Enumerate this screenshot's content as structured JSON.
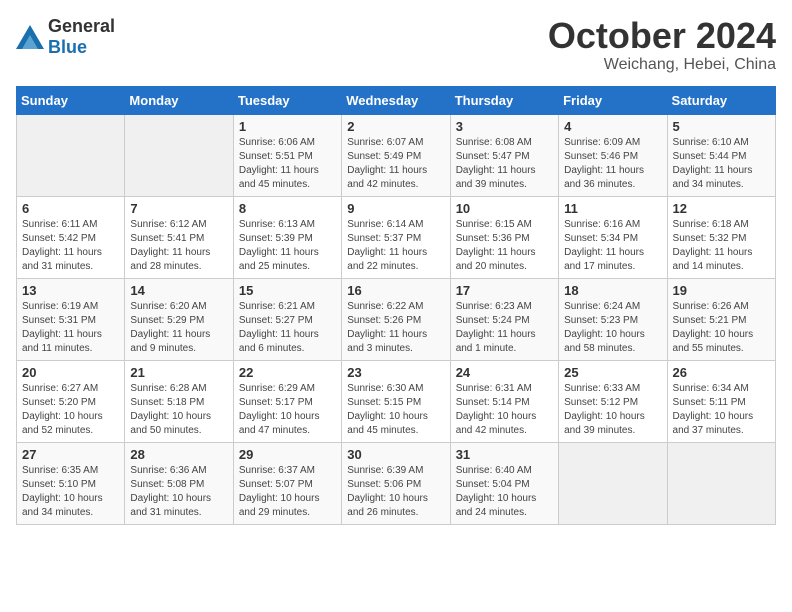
{
  "logo": {
    "general": "General",
    "blue": "Blue"
  },
  "header": {
    "month": "October 2024",
    "location": "Weichang, Hebei, China"
  },
  "weekdays": [
    "Sunday",
    "Monday",
    "Tuesday",
    "Wednesday",
    "Thursday",
    "Friday",
    "Saturday"
  ],
  "weeks": [
    [
      {
        "day": "",
        "sunrise": "",
        "sunset": "",
        "daylight": ""
      },
      {
        "day": "",
        "sunrise": "",
        "sunset": "",
        "daylight": ""
      },
      {
        "day": "1",
        "sunrise": "Sunrise: 6:06 AM",
        "sunset": "Sunset: 5:51 PM",
        "daylight": "Daylight: 11 hours and 45 minutes."
      },
      {
        "day": "2",
        "sunrise": "Sunrise: 6:07 AM",
        "sunset": "Sunset: 5:49 PM",
        "daylight": "Daylight: 11 hours and 42 minutes."
      },
      {
        "day": "3",
        "sunrise": "Sunrise: 6:08 AM",
        "sunset": "Sunset: 5:47 PM",
        "daylight": "Daylight: 11 hours and 39 minutes."
      },
      {
        "day": "4",
        "sunrise": "Sunrise: 6:09 AM",
        "sunset": "Sunset: 5:46 PM",
        "daylight": "Daylight: 11 hours and 36 minutes."
      },
      {
        "day": "5",
        "sunrise": "Sunrise: 6:10 AM",
        "sunset": "Sunset: 5:44 PM",
        "daylight": "Daylight: 11 hours and 34 minutes."
      }
    ],
    [
      {
        "day": "6",
        "sunrise": "Sunrise: 6:11 AM",
        "sunset": "Sunset: 5:42 PM",
        "daylight": "Daylight: 11 hours and 31 minutes."
      },
      {
        "day": "7",
        "sunrise": "Sunrise: 6:12 AM",
        "sunset": "Sunset: 5:41 PM",
        "daylight": "Daylight: 11 hours and 28 minutes."
      },
      {
        "day": "8",
        "sunrise": "Sunrise: 6:13 AM",
        "sunset": "Sunset: 5:39 PM",
        "daylight": "Daylight: 11 hours and 25 minutes."
      },
      {
        "day": "9",
        "sunrise": "Sunrise: 6:14 AM",
        "sunset": "Sunset: 5:37 PM",
        "daylight": "Daylight: 11 hours and 22 minutes."
      },
      {
        "day": "10",
        "sunrise": "Sunrise: 6:15 AM",
        "sunset": "Sunset: 5:36 PM",
        "daylight": "Daylight: 11 hours and 20 minutes."
      },
      {
        "day": "11",
        "sunrise": "Sunrise: 6:16 AM",
        "sunset": "Sunset: 5:34 PM",
        "daylight": "Daylight: 11 hours and 17 minutes."
      },
      {
        "day": "12",
        "sunrise": "Sunrise: 6:18 AM",
        "sunset": "Sunset: 5:32 PM",
        "daylight": "Daylight: 11 hours and 14 minutes."
      }
    ],
    [
      {
        "day": "13",
        "sunrise": "Sunrise: 6:19 AM",
        "sunset": "Sunset: 5:31 PM",
        "daylight": "Daylight: 11 hours and 11 minutes."
      },
      {
        "day": "14",
        "sunrise": "Sunrise: 6:20 AM",
        "sunset": "Sunset: 5:29 PM",
        "daylight": "Daylight: 11 hours and 9 minutes."
      },
      {
        "day": "15",
        "sunrise": "Sunrise: 6:21 AM",
        "sunset": "Sunset: 5:27 PM",
        "daylight": "Daylight: 11 hours and 6 minutes."
      },
      {
        "day": "16",
        "sunrise": "Sunrise: 6:22 AM",
        "sunset": "Sunset: 5:26 PM",
        "daylight": "Daylight: 11 hours and 3 minutes."
      },
      {
        "day": "17",
        "sunrise": "Sunrise: 6:23 AM",
        "sunset": "Sunset: 5:24 PM",
        "daylight": "Daylight: 11 hours and 1 minute."
      },
      {
        "day": "18",
        "sunrise": "Sunrise: 6:24 AM",
        "sunset": "Sunset: 5:23 PM",
        "daylight": "Daylight: 10 hours and 58 minutes."
      },
      {
        "day": "19",
        "sunrise": "Sunrise: 6:26 AM",
        "sunset": "Sunset: 5:21 PM",
        "daylight": "Daylight: 10 hours and 55 minutes."
      }
    ],
    [
      {
        "day": "20",
        "sunrise": "Sunrise: 6:27 AM",
        "sunset": "Sunset: 5:20 PM",
        "daylight": "Daylight: 10 hours and 52 minutes."
      },
      {
        "day": "21",
        "sunrise": "Sunrise: 6:28 AM",
        "sunset": "Sunset: 5:18 PM",
        "daylight": "Daylight: 10 hours and 50 minutes."
      },
      {
        "day": "22",
        "sunrise": "Sunrise: 6:29 AM",
        "sunset": "Sunset: 5:17 PM",
        "daylight": "Daylight: 10 hours and 47 minutes."
      },
      {
        "day": "23",
        "sunrise": "Sunrise: 6:30 AM",
        "sunset": "Sunset: 5:15 PM",
        "daylight": "Daylight: 10 hours and 45 minutes."
      },
      {
        "day": "24",
        "sunrise": "Sunrise: 6:31 AM",
        "sunset": "Sunset: 5:14 PM",
        "daylight": "Daylight: 10 hours and 42 minutes."
      },
      {
        "day": "25",
        "sunrise": "Sunrise: 6:33 AM",
        "sunset": "Sunset: 5:12 PM",
        "daylight": "Daylight: 10 hours and 39 minutes."
      },
      {
        "day": "26",
        "sunrise": "Sunrise: 6:34 AM",
        "sunset": "Sunset: 5:11 PM",
        "daylight": "Daylight: 10 hours and 37 minutes."
      }
    ],
    [
      {
        "day": "27",
        "sunrise": "Sunrise: 6:35 AM",
        "sunset": "Sunset: 5:10 PM",
        "daylight": "Daylight: 10 hours and 34 minutes."
      },
      {
        "day": "28",
        "sunrise": "Sunrise: 6:36 AM",
        "sunset": "Sunset: 5:08 PM",
        "daylight": "Daylight: 10 hours and 31 minutes."
      },
      {
        "day": "29",
        "sunrise": "Sunrise: 6:37 AM",
        "sunset": "Sunset: 5:07 PM",
        "daylight": "Daylight: 10 hours and 29 minutes."
      },
      {
        "day": "30",
        "sunrise": "Sunrise: 6:39 AM",
        "sunset": "Sunset: 5:06 PM",
        "daylight": "Daylight: 10 hours and 26 minutes."
      },
      {
        "day": "31",
        "sunrise": "Sunrise: 6:40 AM",
        "sunset": "Sunset: 5:04 PM",
        "daylight": "Daylight: 10 hours and 24 minutes."
      },
      {
        "day": "",
        "sunrise": "",
        "sunset": "",
        "daylight": ""
      },
      {
        "day": "",
        "sunrise": "",
        "sunset": "",
        "daylight": ""
      }
    ]
  ]
}
